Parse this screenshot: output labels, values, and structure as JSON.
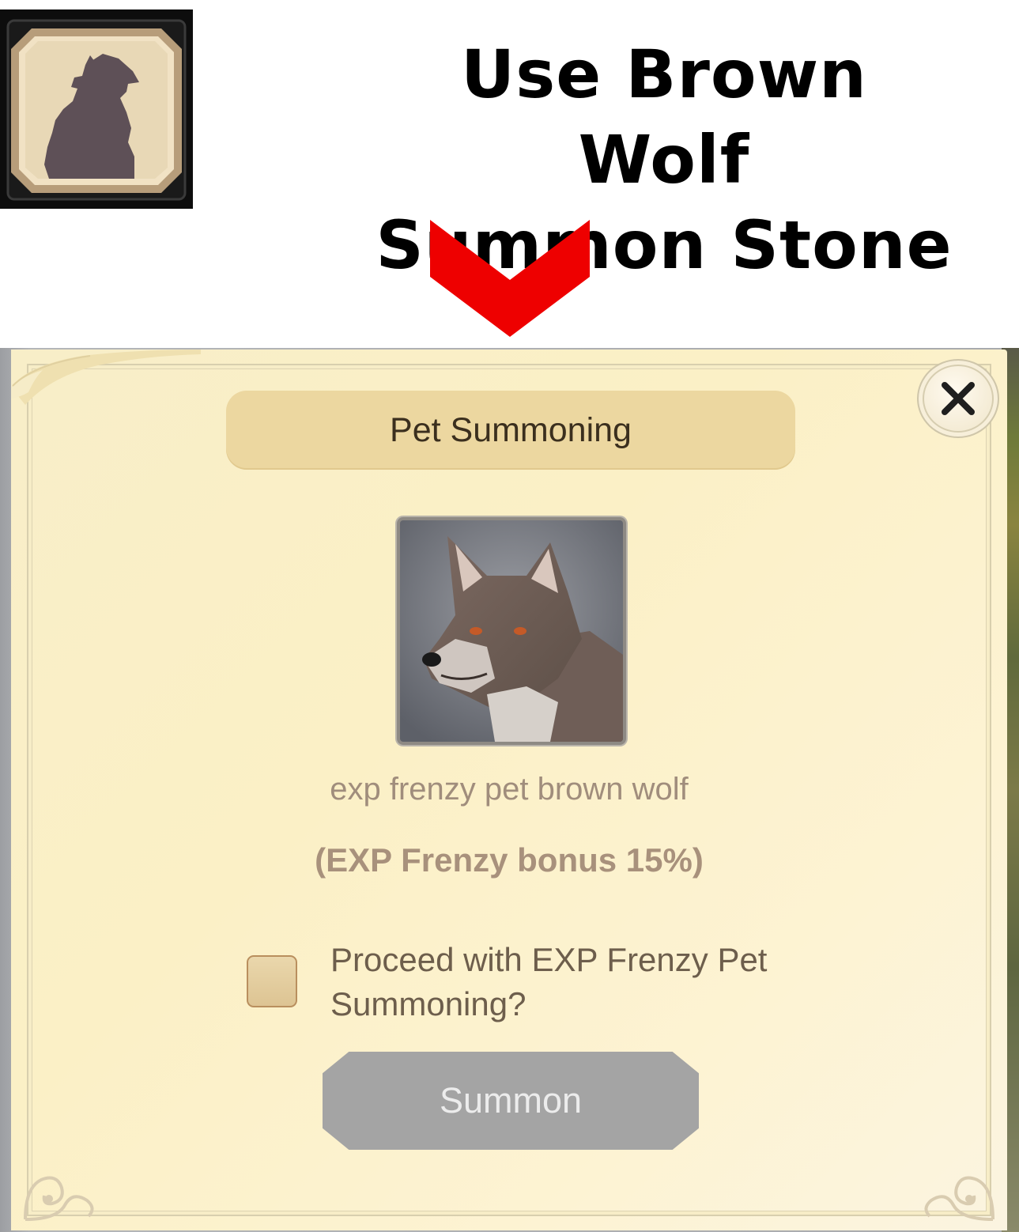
{
  "instruction": {
    "line1": "Use Brown Wolf",
    "line2": "Summon Stone"
  },
  "item_icon": {
    "icon": "howling-wolf-icon"
  },
  "dialog": {
    "title": "Pet Summoning",
    "close_icon": "close-icon",
    "pet_name": "exp frenzy pet brown wolf",
    "bonus_text": "(EXP Frenzy bonus 15%)",
    "confirm_checkbox": {
      "checked": false,
      "label_line1": "Proceed with EXP Frenzy Pet",
      "label_line2": "Summoning?"
    },
    "summon_button": {
      "label": "Summon",
      "enabled": false
    }
  },
  "colors": {
    "arrow": "#ee0000",
    "parchment": "#fbf0c6",
    "title_bar": "#ecd7a0",
    "button_disabled": "#a4a4a4"
  }
}
